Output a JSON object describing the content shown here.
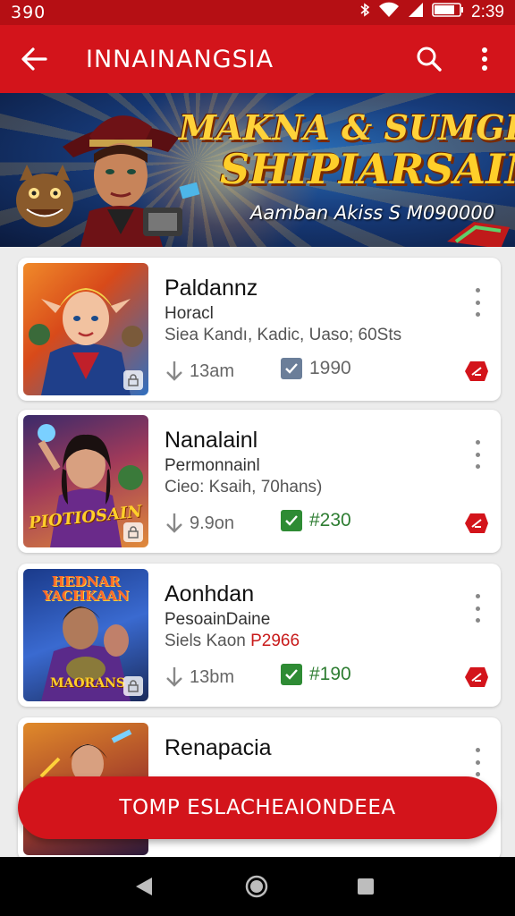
{
  "status_bar": {
    "left_text": "390",
    "time": "2:39"
  },
  "app_bar": {
    "title": "INNAINANGSIA"
  },
  "banner": {
    "line1": "MAKNA & SUMGESN",
    "line2": "SHIPIARSAIN",
    "line3": "Aamban Akiss S M090000"
  },
  "cards": [
    {
      "name": "Paldannz",
      "sub": "Horacl",
      "meta": "Siea Kandı, Kadic, Uaso; 60Sts",
      "meta_highlight": "",
      "stat1": "13am",
      "stat2": "1990",
      "stat2_color": "#666666",
      "check_color": "#6b7e99"
    },
    {
      "name": "Nanalainl",
      "sub": "Permonnainl",
      "meta": "Cieo: Ksaih, 70hans)",
      "meta_highlight": "",
      "stat1": "9.9on",
      "stat2": "#230",
      "stat2_color": "#2e7d32",
      "check_color": "#2e8b34"
    },
    {
      "name": "Aonhdan",
      "sub": "PesoainDaine",
      "meta": "Siels Kaon ",
      "meta_highlight": "P2966",
      "stat1": "13bm",
      "stat2": "#190",
      "stat2_color": "#2e7d32",
      "check_color": "#2e8b34"
    },
    {
      "name": "Renapacia",
      "sub": "",
      "meta": "",
      "meta_highlight": "",
      "stat1": "",
      "stat2": "",
      "stat2_color": "#666666",
      "check_color": "#2e8b34"
    }
  ],
  "cta": {
    "label": "TOMP ESLACHEAIONDEEA"
  },
  "thumb_texts": {
    "card2": "PIOTIOSAIN",
    "card3_top": "HEDNAR YACHKAAN",
    "card3_bottom": "MAORANS"
  },
  "colors": {
    "primary": "#d3141b",
    "status": "#b50f14",
    "nav": "#000000"
  }
}
